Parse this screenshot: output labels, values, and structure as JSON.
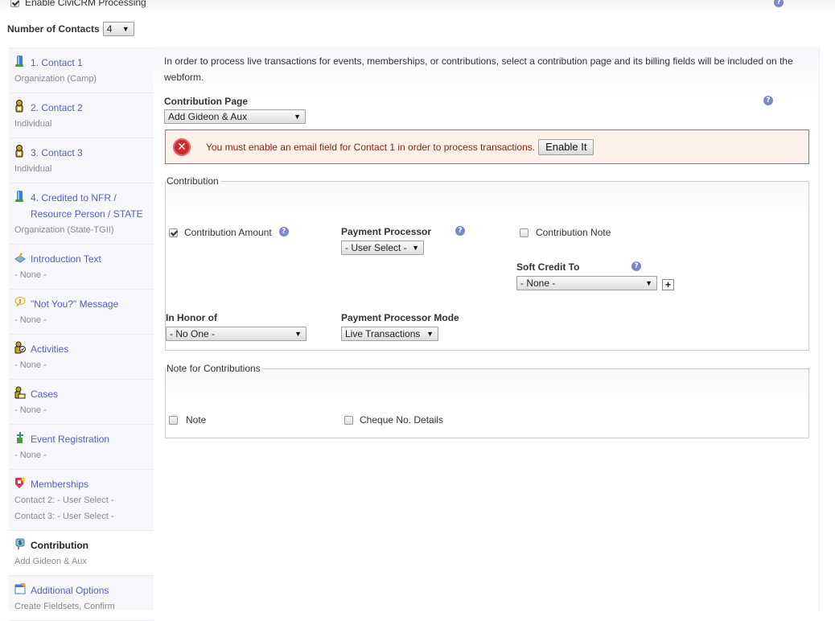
{
  "header": {
    "enable_processing": {
      "label": "Enable CiviCRM Processing",
      "checked": true
    },
    "number_of_contacts": {
      "label": "Number of Contacts",
      "value": "4"
    },
    "help_icon": "help-icon"
  },
  "sidebar": {
    "items": [
      {
        "icon": "organization-icon",
        "label": "1. Contact 1",
        "subs": [
          "Organization (Camp)"
        ],
        "active": false
      },
      {
        "icon": "individual-icon",
        "label": "2. Contact 2",
        "subs": [
          "Individual"
        ],
        "active": false
      },
      {
        "icon": "individual-icon",
        "label": "3. Contact 3",
        "subs": [
          "Individual"
        ],
        "active": false
      },
      {
        "icon": "organization-icon",
        "label": "4. Credited to NFR / Resource Person / STATE",
        "subs": [
          "Organization (State-TGII)"
        ],
        "active": false
      },
      {
        "icon": "edit-text-icon",
        "label": "Introduction Text",
        "subs": [
          "- None -"
        ],
        "active": false
      },
      {
        "icon": "speech-bubble-icon",
        "label": "\"Not You?\" Message",
        "subs": [
          "- None -"
        ],
        "active": false
      },
      {
        "icon": "activities-icon",
        "label": "Activities",
        "subs": [
          "- None -"
        ],
        "active": false
      },
      {
        "icon": "cases-icon",
        "label": "Cases",
        "subs": [
          "- None -"
        ],
        "active": false
      },
      {
        "icon": "event-icon",
        "label": "Event Registration",
        "subs": [
          "- None -"
        ],
        "active": false
      },
      {
        "icon": "memberships-icon",
        "label": "Memberships",
        "subs": [
          "Contact 2: - User Select -",
          "Contact 3: - User Select -"
        ],
        "active": false
      },
      {
        "icon": "contribution-icon",
        "label": "Contribution",
        "subs": [
          "Add Gideon & Aux"
        ],
        "active": true
      },
      {
        "icon": "options-icon",
        "label": "Additional Options",
        "subs": [
          "Create Fieldsets, Confirm"
        ],
        "active": false
      }
    ]
  },
  "main": {
    "intro": "In order to process live transactions for events, memberships, or contributions, select a contribution page and its billing fields will be included on the webform.",
    "contribution_page": {
      "label": "Contribution Page",
      "value": "Add Gideon & Aux"
    },
    "error": {
      "message": "You must enable an email field for Contact 1 in order to process transactions.",
      "button": "Enable It"
    },
    "contribution_fieldset": {
      "legend": "Contribution",
      "contribution_amount": {
        "label": "Contribution Amount",
        "checked": true
      },
      "payment_processor": {
        "label": "Payment Processor",
        "value": "- User Select -"
      },
      "contribution_note": {
        "label": "Contribution Note",
        "checked": false
      },
      "soft_credit_to": {
        "label": "Soft Credit To",
        "value": "- None -",
        "add_label": "+"
      },
      "in_honor_of": {
        "label": "In Honor of",
        "value": "- No One -"
      },
      "payment_processor_mode": {
        "label": "Payment Processor Mode",
        "value": "Live Transactions"
      }
    },
    "note_fieldset": {
      "legend": "Note for Contributions",
      "note": {
        "label": "Note",
        "checked": false
      },
      "cheque_details": {
        "label": "Cheque No. Details",
        "checked": false
      }
    }
  },
  "colors": {
    "link": "#5560b8",
    "error_border": "#d8642e",
    "error_bg": "#fdf1ea",
    "error_text": "#8a1f11",
    "help_icon": "#7c87c9"
  }
}
